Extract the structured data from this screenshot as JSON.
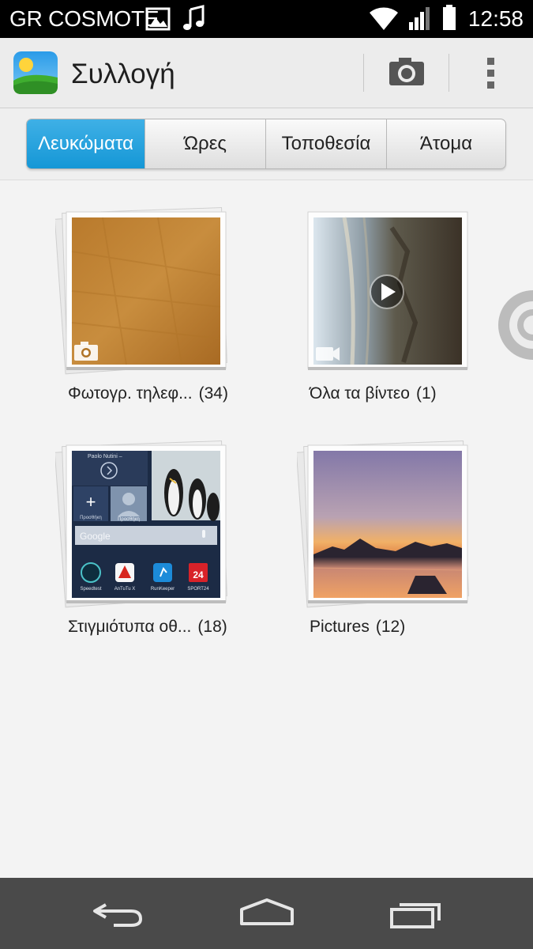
{
  "status_bar": {
    "carrier": "GR COSMOTE",
    "time": "12:58",
    "icons": [
      "image-notification-icon",
      "music-note-icon",
      "wifi-icon",
      "signal-icon",
      "battery-icon"
    ]
  },
  "action_bar": {
    "title": "Συλλογή",
    "icons": [
      "gallery-app-icon",
      "camera-icon",
      "overflow-menu-icon"
    ]
  },
  "tabs": [
    {
      "label": "Λευκώματα",
      "active": true
    },
    {
      "label": "Ώρες",
      "active": false
    },
    {
      "label": "Τοποθεσία",
      "active": false
    },
    {
      "label": "Άτομα",
      "active": false
    }
  ],
  "albums": [
    {
      "name": "Φωτογρ. τηλεφ...",
      "count": "(34)",
      "type_icon": "camera-icon"
    },
    {
      "name": "Όλα τα βίντεο",
      "count": "(1)",
      "type_icon": "video-icon"
    },
    {
      "name": "Στιγμιότυπα οθ...",
      "count": "(18)",
      "type_icon": ""
    },
    {
      "name": "Pictures",
      "count": "(12)",
      "type_icon": ""
    }
  ],
  "screenshot_thumb": {
    "contact": "Paolo Nutini – ",
    "search_brand": "Google",
    "add_label": "Προσθήκη",
    "add_label_2": "Προσθήκη",
    "apps": [
      "Speedtest",
      "AnTuTu X",
      "RunKeeper",
      "SPORT24"
    ]
  },
  "colors": {
    "accent_tab": "#1fa0dc",
    "action_bar": "#ececec",
    "nav_bar": "#4a4a4a"
  },
  "nav_bar": {
    "icons": [
      "back-icon",
      "home-icon",
      "recent-apps-icon"
    ]
  }
}
